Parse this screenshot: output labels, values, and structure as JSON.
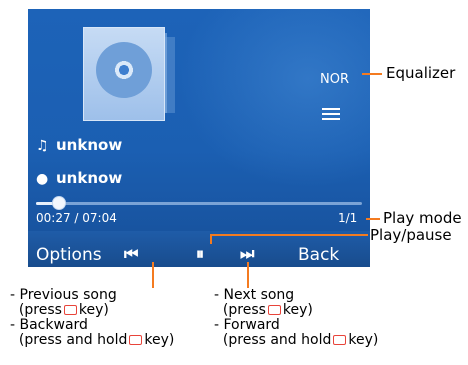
{
  "screen": {
    "equalizer_badge": "NOR",
    "track_title": "unknow",
    "artist": "unknow",
    "elapsed_total": "00:27 / 07:04",
    "playlist_position": "1/1",
    "progress_fraction": 0.07
  },
  "softkeys": {
    "left": "Options",
    "right": "Back"
  },
  "controls": {
    "prev_glyph": "⏮",
    "play_pause_glyph": "⏸",
    "next_glyph": "⏭"
  },
  "callouts": {
    "equalizer": "Equalizer",
    "play_mode": "Play mode",
    "play_pause": "Play/pause"
  },
  "notes": {
    "prev_line1": "- Previous song",
    "prev_line2a": "(press",
    "prev_line2b": "key)",
    "back_line1": "- Backward",
    "back_line2a": "(press and hold",
    "back_line2b": "key)",
    "next_line1": "- Next song",
    "next_line2a": "(press",
    "next_line2b": "key)",
    "fwd_line1": "- Forward",
    "fwd_line2a": "(press and hold",
    "fwd_line2b": "key)"
  },
  "icons": {
    "note": "music-note-icon",
    "artist": "person-icon",
    "equalizer_list": "list-icon",
    "key": "softkey-icon"
  },
  "colors": {
    "screen_blue": "#1b5fb2",
    "callout_line": "#f47b20",
    "key_outline": "#e8443a"
  }
}
